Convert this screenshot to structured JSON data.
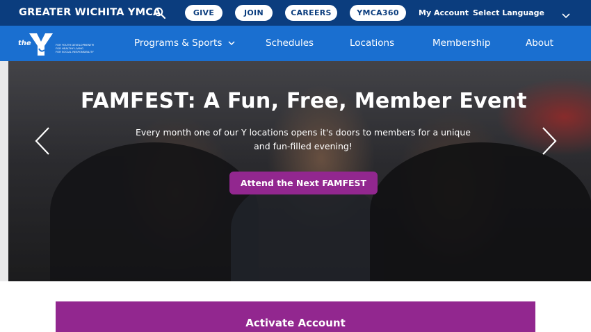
{
  "topbar": {
    "site_title": "GREATER WICHITA YMCA",
    "search_icon": "search-icon",
    "buttons": {
      "give": "GIVE",
      "join": "JOIN",
      "careers": "CAREERS",
      "ymca360": "YMCA360"
    },
    "my_account": "My Account",
    "language": "Select Language"
  },
  "logo": {
    "the": "the",
    "tagline": [
      "FOR YOUTH DEVELOPMENT®",
      "FOR HEALTHY LIVING",
      "FOR SOCIAL RESPONSIBILITY"
    ]
  },
  "nav": {
    "programs": "Programs & Sports",
    "schedules": "Schedules",
    "locations": "Locations",
    "membership": "Membership",
    "about": "About"
  },
  "hero": {
    "title": "FAMFEST: A Fun, Free, Member Event",
    "subtitle": "Every month one of our Y locations opens it's doors to members for a unique and fun-filled evening!",
    "cta": "Attend the Next FAMFEST"
  },
  "activate": {
    "label": "Activate Account"
  },
  "colors": {
    "topbar": "#0b3d7e",
    "nav": "#1a6fd0",
    "accent_purple": "#92278f",
    "white": "#ffffff"
  }
}
